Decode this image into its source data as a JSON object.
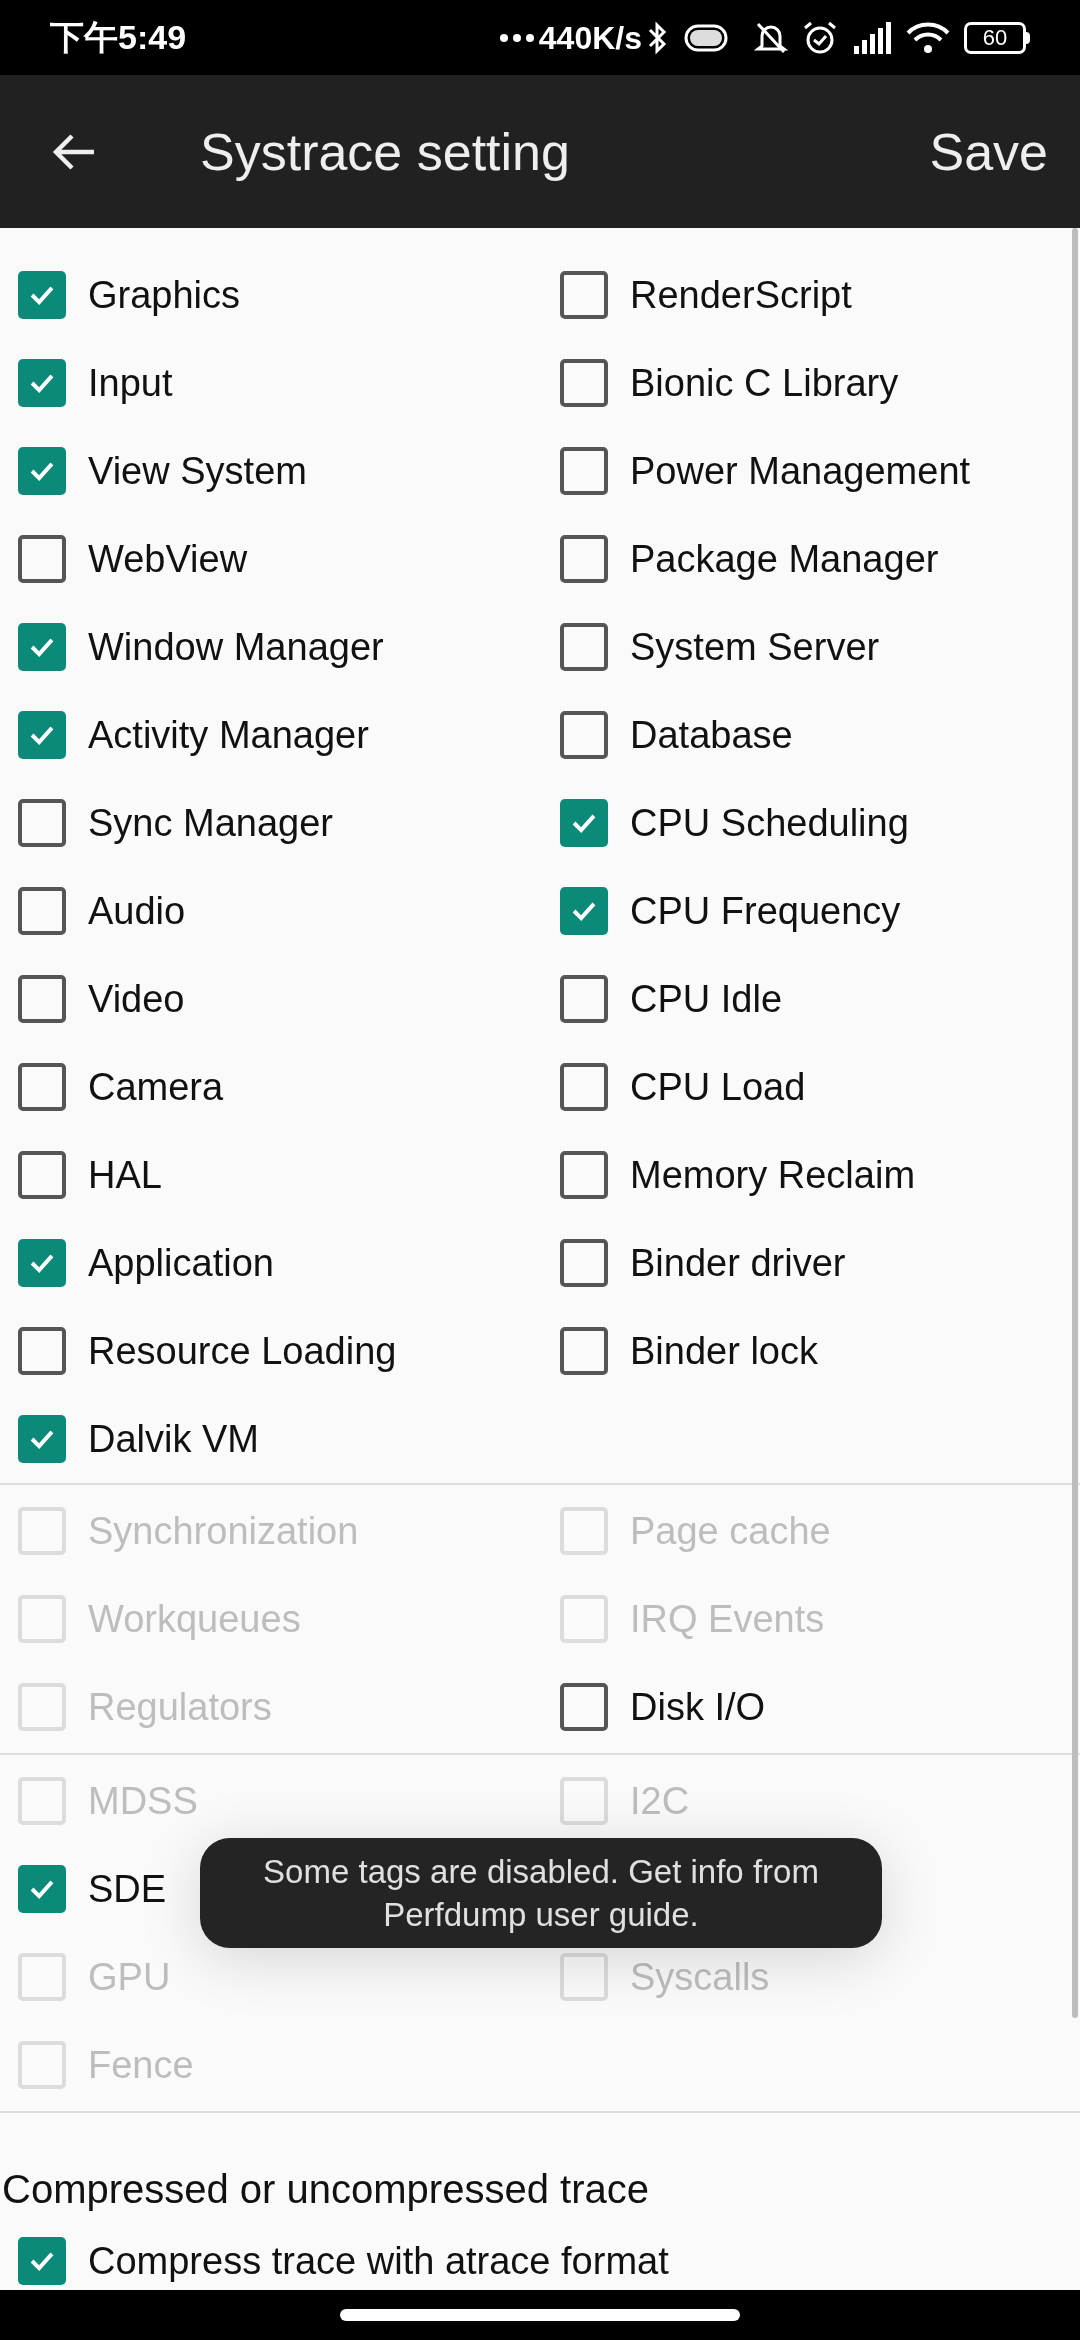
{
  "status_bar": {
    "time": "下午5:49",
    "net_speed": "440K/s",
    "battery": "60"
  },
  "app_bar": {
    "title": "Systrace setting",
    "action": "Save"
  },
  "sections": [
    {
      "rows": [
        {
          "left": {
            "label": "Graphics",
            "checked": true,
            "disabled": false
          },
          "right": {
            "label": "RenderScript",
            "checked": false,
            "disabled": false
          }
        },
        {
          "left": {
            "label": "Input",
            "checked": true,
            "disabled": false
          },
          "right": {
            "label": "Bionic C Library",
            "checked": false,
            "disabled": false
          }
        },
        {
          "left": {
            "label": "View System",
            "checked": true,
            "disabled": false
          },
          "right": {
            "label": "Power Management",
            "checked": false,
            "disabled": false
          }
        },
        {
          "left": {
            "label": "WebView",
            "checked": false,
            "disabled": false
          },
          "right": {
            "label": "Package Manager",
            "checked": false,
            "disabled": false
          }
        },
        {
          "left": {
            "label": "Window Manager",
            "checked": true,
            "disabled": false
          },
          "right": {
            "label": "System Server",
            "checked": false,
            "disabled": false
          }
        },
        {
          "left": {
            "label": "Activity Manager",
            "checked": true,
            "disabled": false
          },
          "right": {
            "label": "Database",
            "checked": false,
            "disabled": false
          }
        },
        {
          "left": {
            "label": "Sync Manager",
            "checked": false,
            "disabled": false
          },
          "right": {
            "label": "CPU Scheduling",
            "checked": true,
            "disabled": false
          }
        },
        {
          "left": {
            "label": "Audio",
            "checked": false,
            "disabled": false
          },
          "right": {
            "label": "CPU Frequency",
            "checked": true,
            "disabled": false
          }
        },
        {
          "left": {
            "label": "Video",
            "checked": false,
            "disabled": false
          },
          "right": {
            "label": "CPU Idle",
            "checked": false,
            "disabled": false
          }
        },
        {
          "left": {
            "label": "Camera",
            "checked": false,
            "disabled": false
          },
          "right": {
            "label": "CPU Load",
            "checked": false,
            "disabled": false
          }
        },
        {
          "left": {
            "label": "HAL",
            "checked": false,
            "disabled": false
          },
          "right": {
            "label": "Memory Reclaim",
            "checked": false,
            "disabled": false
          }
        },
        {
          "left": {
            "label": "Application",
            "checked": true,
            "disabled": false
          },
          "right": {
            "label": "Binder driver",
            "checked": false,
            "disabled": false
          }
        },
        {
          "left": {
            "label": "Resource Loading",
            "checked": false,
            "disabled": false
          },
          "right": {
            "label": "Binder lock",
            "checked": false,
            "disabled": false
          }
        },
        {
          "left": {
            "label": "Dalvik VM",
            "checked": true,
            "disabled": false
          }
        }
      ]
    },
    {
      "rows": [
        {
          "left": {
            "label": "Synchronization",
            "checked": false,
            "disabled": true
          },
          "right": {
            "label": "Page cache",
            "checked": false,
            "disabled": true
          }
        },
        {
          "left": {
            "label": "Workqueues",
            "checked": false,
            "disabled": true
          },
          "right": {
            "label": "IRQ Events",
            "checked": false,
            "disabled": true
          }
        },
        {
          "left": {
            "label": "Regulators",
            "checked": false,
            "disabled": true
          },
          "right": {
            "label": "Disk I/O",
            "checked": false,
            "disabled": false
          }
        }
      ]
    },
    {
      "rows": [
        {
          "left": {
            "label": "MDSS",
            "checked": false,
            "disabled": true
          },
          "right": {
            "label": "I2C",
            "checked": false,
            "disabled": true
          }
        },
        {
          "left": {
            "label": "SDE",
            "checked": true,
            "disabled": false
          }
        },
        {
          "left": {
            "label": "GPU",
            "checked": false,
            "disabled": true
          },
          "right": {
            "label": "Syscalls",
            "checked": false,
            "disabled": true
          }
        },
        {
          "left": {
            "label": "Fence",
            "checked": false,
            "disabled": true
          }
        }
      ]
    }
  ],
  "compression": {
    "heading": "Compressed or uncompressed trace",
    "option": {
      "label": "Compress trace with atrace format",
      "checked": true,
      "disabled": false
    }
  },
  "toast": "Some tags are disabled. Get info from Perfdump user guide."
}
